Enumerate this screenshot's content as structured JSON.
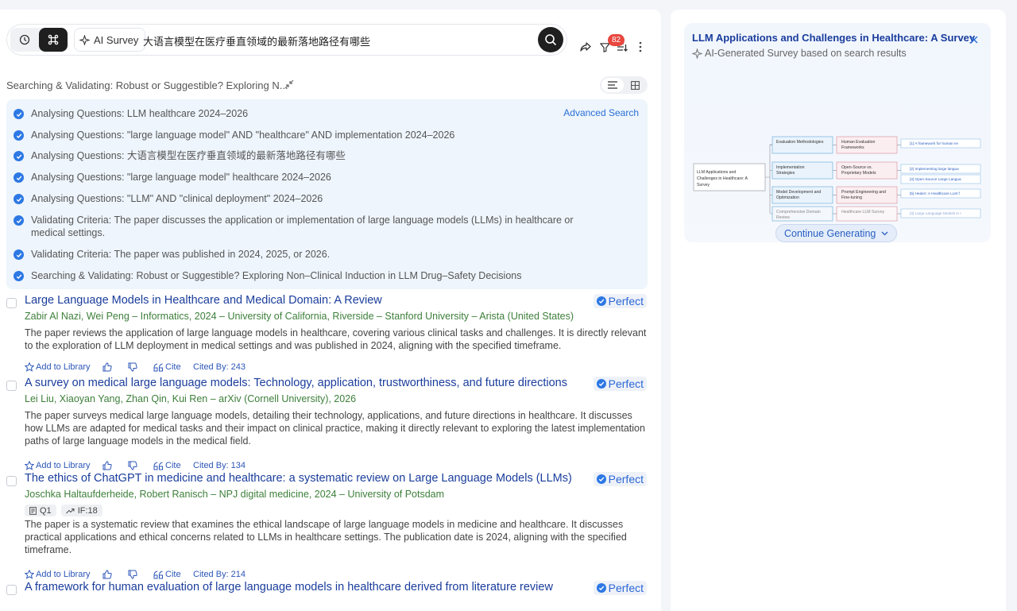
{
  "search": {
    "mode_label": "AI Survey",
    "query": "大语言模型在医疗垂直领域的最新落地路径有哪些",
    "filter_count": "82"
  },
  "status": {
    "line": "Searching & Validating: Robust or Suggestible? Exploring N..."
  },
  "progress": {
    "advanced_search": "Advanced Search",
    "steps": [
      "Analysing Questions: LLM healthcare 2024–2026",
      "Analysing Questions: \"large language model\" AND \"healthcare\" AND implementation 2024–2026",
      "Analysing Questions: 大语言模型在医疗垂直领域的最新落地路径有哪些",
      "Analysing Questions: \"large language model\" healthcare 2024–2026",
      "Analysing Questions: \"LLM\" AND \"clinical deployment\" 2024–2026",
      "Validating Criteria: The paper discusses the application or implementation of large language models (LLMs) in healthcare or medical settings.",
      "Validating Criteria: The paper was published in 2024, 2025, or 2026.",
      "Searching & Validating: Robust or Suggestible? Exploring Non–Clinical Induction in LLM Drug–Safety Decisions"
    ]
  },
  "actions": {
    "add": "Add to Library",
    "cite": "Cite"
  },
  "results": [
    {
      "title": "Large Language Models in Healthcare and Medical Domain: A Review",
      "badge": "Perfect",
      "authors": "Zabir Al Nazi, Wei Peng – Informatics, 2024 – University of California, Riverside – Stanford University – Arista (United States)",
      "summary": "The paper reviews the application of large language models in healthcare, covering various clinical tasks and challenges. It is directly relevant to the exploration of LLM deployment in medical settings and was published in 2024, aligning with the specified timeframe.",
      "cited": "Cited By: 243"
    },
    {
      "title": "A survey on medical large language models: Technology, application, trustworthiness, and future directions",
      "badge": "Perfect",
      "authors": "Lei Liu, Xiaoyan Yang, Zhan Qin, Kui Ren – arXiv (Cornell University), 2026",
      "summary": "The paper surveys medical large language models, detailing their technology, applications, and future directions in healthcare. It discusses how LLMs are adapted for medical tasks and their impact on clinical practice, making it directly relevant to exploring the latest implementation paths of large language models in the medical field.",
      "cited": "Cited By: 134"
    },
    {
      "title": "The ethics of ChatGPT in medicine and healthcare: a systematic review on Large Language Models (LLMs)",
      "badge": "Perfect",
      "authors": "Joschka Haltaufderheide, Robert Ranisch – NPJ digital medicine, 2024 – University of Potsdam",
      "tag_q": "Q1",
      "tag_if": "IF:18",
      "summary": "The paper is a systematic review that examines the ethical landscape of large language models in medicine and healthcare. It discusses practical applications and ethical concerns related to LLMs in healthcare settings. The publication date is 2024, aligning with the specified timeframe.",
      "cited": "Cited By: 214"
    },
    {
      "title": "A framework for human evaluation of large language models in healthcare derived from literature review",
      "badge": "Perfect"
    }
  ],
  "survey": {
    "title": "LLM Applications and Challenges in Healthcare: A Survey",
    "subtitle": "AI-Generated Survey based on search results",
    "continue": "Continue Generating",
    "mindmap": {
      "root": [
        "LLM Applications and",
        "Challenges in Healthcare: A",
        "Survey"
      ],
      "branches": [
        {
          "main": [
            "Evaluation Methodologies"
          ],
          "sub": [
            "Human Evaluation",
            "Frameworks"
          ],
          "leaf": "[1] A framework for human ev"
        },
        {
          "main": [
            "Implementation",
            "Strategies"
          ],
          "sub": [
            "Open-Source vs.",
            "Proprietary Models"
          ],
          "leaf": "[2] Implementing large langua",
          "leaf2": "[4] Open-Source Large Langua"
        },
        {
          "main": [
            "Model Development and",
            "Optimization"
          ],
          "sub": [
            "Prompt Engineering and",
            "Fine-tuning"
          ],
          "leaf": "[5] HealAI: A Healthcare LLM f"
        },
        {
          "main": [
            "Comprehensive Domain",
            "Review"
          ],
          "sub": [
            "Healthcare LLM Survey"
          ],
          "leaf": "[3] Large Language Models in I"
        }
      ]
    }
  }
}
